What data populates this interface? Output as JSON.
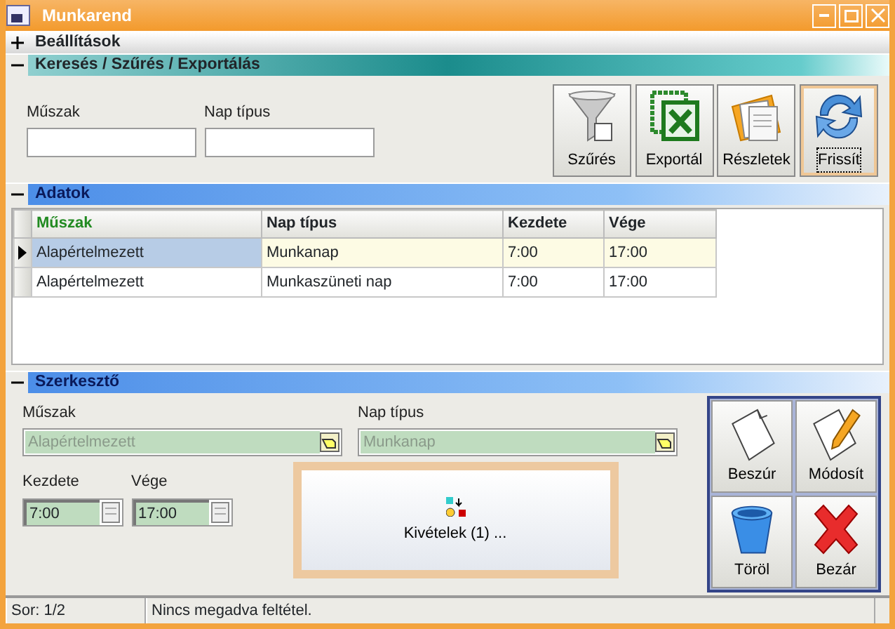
{
  "window": {
    "title": "Munkarend"
  },
  "sections": [
    {
      "title": "Beállítások",
      "expanded": false,
      "kind": "plain"
    },
    {
      "title": "Keresés / Szűrés / Exportálás",
      "expanded": true,
      "kind": "teal"
    },
    {
      "title": "Adatok",
      "expanded": true,
      "kind": "blue"
    },
    {
      "title": "Szerkesztő",
      "expanded": true,
      "kind": "blue"
    }
  ],
  "search": {
    "fields": [
      {
        "label": "Műszak"
      },
      {
        "label": "Nap típus"
      }
    ],
    "buttons": [
      {
        "label": "Szűrés",
        "kind": "filter",
        "focused": false
      },
      {
        "label": "Exportál",
        "kind": "export",
        "focused": false
      },
      {
        "label": "Részletek",
        "kind": "details",
        "focused": false
      },
      {
        "label": "Frissít",
        "kind": "refresh",
        "focused": true
      }
    ]
  },
  "grid": {
    "columns": [
      {
        "label": "Műszak",
        "sorted": true
      },
      {
        "label": "Nap típus",
        "sorted": false
      },
      {
        "label": "Kezdete",
        "sorted": false
      },
      {
        "label": "Vége",
        "sorted": false
      }
    ],
    "rows": [
      {
        "selected": true,
        "cells": [
          "Alapértelmezett",
          "Munkanap",
          "7:00",
          "17:00"
        ]
      },
      {
        "selected": false,
        "cells": [
          "Alapértelmezett",
          "Munkaszüneti nap",
          "7:00",
          "17:00"
        ]
      }
    ]
  },
  "editor": {
    "fields": [
      {
        "label": "Műszak",
        "value": "Alapértelmezett"
      },
      {
        "label": "Nap típus",
        "value": "Munkanap"
      }
    ],
    "times": [
      {
        "label": "Kezdete",
        "value": "7:00"
      },
      {
        "label": "Vége",
        "value": "17:00"
      }
    ],
    "exceptions_button": "Kivételek (1) ...",
    "buttons": [
      {
        "label": "Beszúr",
        "kind": "insert"
      },
      {
        "label": "Módosít",
        "kind": "edit"
      },
      {
        "label": "Töröl",
        "kind": "delete"
      },
      {
        "label": "Bezár",
        "kind": "close"
      }
    ]
  },
  "status_bar": [
    "Sor: 1/2",
    "Nincs megadva feltétel."
  ]
}
